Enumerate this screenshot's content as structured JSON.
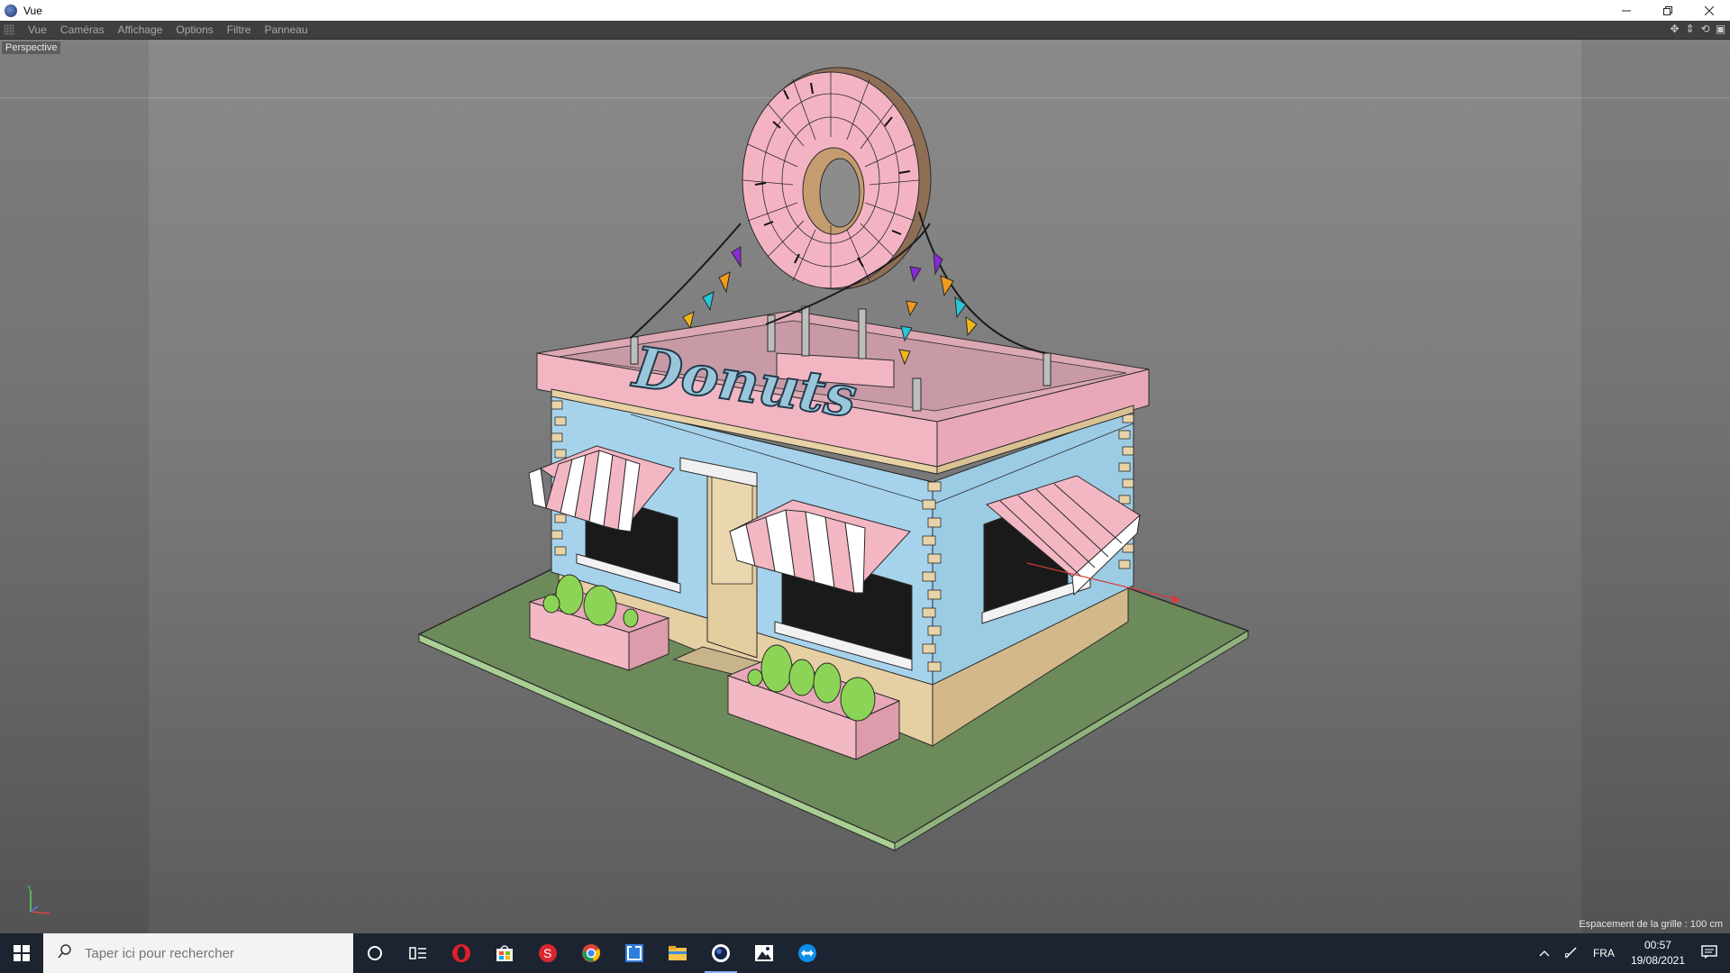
{
  "window": {
    "title": "Vue",
    "controls": [
      "minimize",
      "restore",
      "close"
    ]
  },
  "menu": {
    "items": [
      "Vue",
      "Caméras",
      "Affichage",
      "Options",
      "Filtre",
      "Panneau"
    ]
  },
  "nav_icons": [
    "move-view-icon",
    "zoom-view-icon",
    "rotate-view-icon",
    "toggle-panel-icon"
  ],
  "viewport": {
    "camera_label": "Perspective",
    "grid_spacing": "Espacement de la grille : 100 cm",
    "sign_text": "Donuts"
  },
  "taskbar": {
    "search_placeholder": "Taper ici pour rechercher",
    "apps": [
      "cortana-icon",
      "task-view-icon",
      "opera-icon",
      "store-icon",
      "sketchup-icon",
      "chrome-icon",
      "lightshot-icon",
      "file-explorer-icon",
      "cinema4d-icon",
      "photos-icon",
      "teamviewer-icon"
    ],
    "active_app": "cinema4d-icon",
    "language": "FRA",
    "time": "00:57",
    "date": "19/08/2021"
  },
  "colors": {
    "viewport_top": "#8a8a8a",
    "viewport_bottom": "#5b5b5b",
    "pink": "#f2b8c4",
    "blue": "#a8d4ec",
    "ground": "#6f8a5c",
    "taskbar": "#1c2431"
  }
}
